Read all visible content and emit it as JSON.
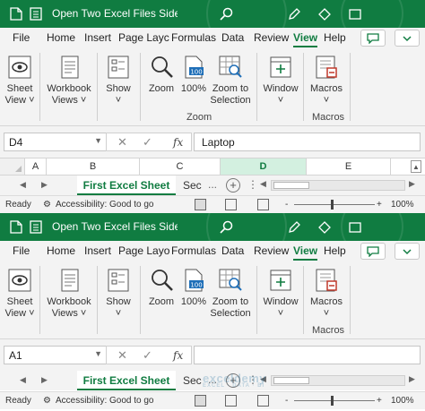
{
  "windows": [
    {
      "title": "Open Two Excel Files Side by...",
      "tabs": [
        "File",
        "Home",
        "Insert",
        "Page Layc",
        "Formulas",
        "Data",
        "Review",
        "View",
        "Help"
      ],
      "active_tab": "View",
      "ribbon": {
        "sheet_view": [
          "Sheet",
          "View ˅"
        ],
        "workbook_views": [
          "Workbook",
          "Views ˅"
        ],
        "show": [
          "Show",
          "˅"
        ],
        "zoom": "Zoom",
        "zoom_100": "100%",
        "zoom_to_selection": [
          "Zoom to",
          "Selection"
        ],
        "zoom_group": "Zoom",
        "window": [
          "Window",
          "˅"
        ],
        "macros": [
          "Macros",
          "˅"
        ],
        "macros_group": "Macros"
      },
      "name_box": "D4",
      "formula_value": "Laptop",
      "columns": [
        "A",
        "B",
        "C",
        "D",
        "E"
      ],
      "selected_column": "D",
      "sheets": [
        "First Excel Sheet",
        "Sec"
      ],
      "more_tabs": "...",
      "status": {
        "ready": "Ready",
        "accessibility": "Accessibility: Good to go",
        "zoom_minus": "-",
        "zoom_plus": "+",
        "zoom_level": "100%"
      }
    },
    {
      "title": "Open Two Excel Files Side by...",
      "tabs": [
        "File",
        "Home",
        "Insert",
        "Page Layo",
        "Formulas",
        "Data",
        "Review",
        "View",
        "Help"
      ],
      "active_tab": "View",
      "ribbon": {
        "sheet_view": [
          "Sheet",
          "View ˅"
        ],
        "workbook_views": [
          "Workbook",
          "Views ˅"
        ],
        "show": [
          "Show",
          "˅"
        ],
        "zoom": "Zoom",
        "zoom_100": "100%",
        "zoom_to_selection": [
          "Zoom to",
          "Selection"
        ],
        "zoom_group": "",
        "window": [
          "Window",
          "˅"
        ],
        "macros": [
          "Macros",
          "˅"
        ],
        "macros_group": "Macros"
      },
      "name_box": "A1",
      "formula_value": "",
      "sheets": [
        "First Excel Sheet",
        "Sec"
      ],
      "more_tabs": "...",
      "status": {
        "ready": "Ready",
        "accessibility": "Accessibility: Good to go",
        "zoom_minus": "-",
        "zoom_plus": "+",
        "zoom_level": "100%"
      }
    }
  ],
  "watermark": {
    "main": "exceldemy",
    "sub": "EXCEL · DATA · BI"
  },
  "colors": {
    "excel_green": "#107c41",
    "ribbon_bg": "#f3f3f3",
    "selected_column_bg": "#d3f0e0"
  },
  "icons": [
    "excel-doc-icon",
    "search-icon",
    "pen-icon",
    "diamond-icon",
    "comment-icon",
    "eye-icon",
    "workbook-icon",
    "show-icon",
    "magnifier-icon",
    "zoom-100-icon",
    "zoom-selection-icon",
    "window-icon",
    "macros-icon",
    "accessibility-icon"
  ]
}
